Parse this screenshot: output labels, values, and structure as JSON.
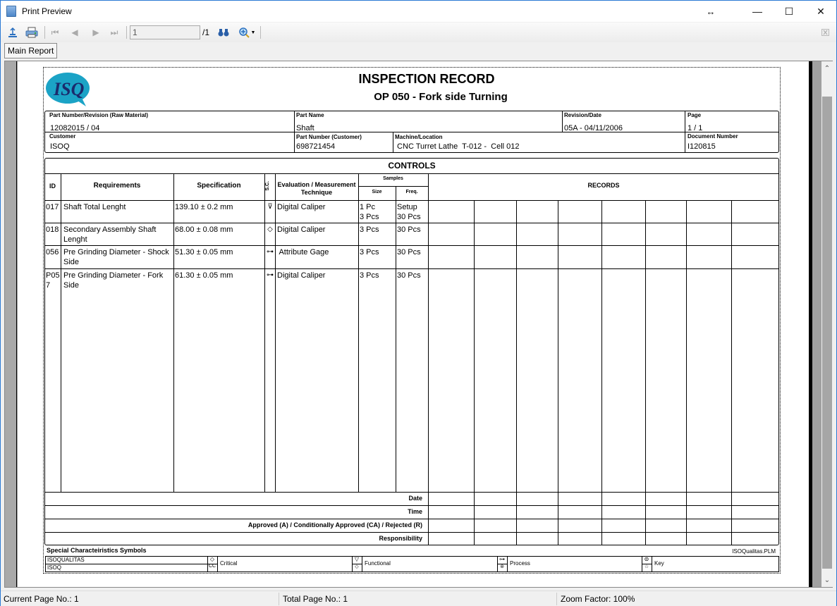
{
  "window": {
    "title": "Print Preview",
    "resize_icon": "↔",
    "minimize": "—",
    "maximize": "☐",
    "close": "✕"
  },
  "toolbar": {
    "export_icon": "export-icon",
    "print_icon": "print-icon",
    "current_page": "1",
    "total_pages": "/1",
    "find_icon": "binoculars-icon",
    "zoom_icon": "zoom-in-icon"
  },
  "tabs": [
    {
      "label": "Main Report"
    }
  ],
  "report": {
    "title": "INSPECTION RECORD",
    "subtitle": "OP 050 - Fork side Turning",
    "logo_text": "ISQ",
    "header": {
      "part_number_label": "Part Number/Revision (Raw Material)",
      "part_number": "12082015 / 04",
      "part_name_label": "Part Name",
      "part_name": "Shaft",
      "revision_label": "Revision/Date",
      "revision": "05A - 04/11/2006",
      "page_label": "Page",
      "page": "1 / 1",
      "customer_label": "Customer",
      "customer": "ISOQ",
      "part_number_customer_label": "Part Number (Customer)",
      "part_number_customer": "698721454",
      "machine_label": "Machine/Location",
      "machine": " CNC Turret Lathe  T-012 -  Cell 012",
      "document_number_label": "Document Number",
      "document_number": "I120815"
    },
    "controls_title": "CONTROLS",
    "columns": {
      "id": "ID",
      "requirements": "Requirements",
      "specification": "Specification",
      "sc": "S.C.",
      "evaluation": "Evaluation / Measurement Technique",
      "samples": "Samples",
      "size": "Size",
      "freq": "Freq.",
      "records": "RECORDS"
    },
    "rows": [
      {
        "id": "017",
        "requirement": "Shaft Total Lenght",
        "specification": "139.10 ± 0.2 mm",
        "sc_symbol": "⊽",
        "evaluation": "Digital Caliper",
        "size": "1 Pc\n3 Pcs",
        "freq": "Setup\n30 Pcs"
      },
      {
        "id": "018",
        "requirement": "Secondary Assembly Shaft Lenght",
        "specification": "68.00  ± 0.08 mm",
        "sc_symbol": "◇",
        "evaluation": "Digital Caliper",
        "size": "3 Pcs",
        "freq": "30 Pcs"
      },
      {
        "id": "056",
        "requirement": "Pre Grinding Diameter - Shock Side",
        "specification": "51.30  ± 0.05 mm",
        "sc_symbol": "⊶",
        "evaluation": " Attribute Gage",
        "size": "3 Pcs",
        "freq": "30 Pcs"
      },
      {
        "id": "P057",
        "requirement": "Pre Grinding Diameter - Fork Side",
        "specification": "61.30  ± 0.05 mm",
        "sc_symbol": "⊶",
        "evaluation": "Digital Caliper",
        "size": "3 Pcs",
        "freq": "30 Pcs"
      }
    ],
    "footer_rows": {
      "date": "Date",
      "time": "Time",
      "approval": "Approved (A) / Conditionally Approved (CA) / Rejected (R)",
      "responsibility": "Responsibility"
    },
    "legend": {
      "title": "Special Characteiristics Symbols",
      "source": "ISOQualitas.PLM",
      "company_1": "ISOQUALITAS",
      "company_2": "ISOQ",
      "items": [
        {
          "label": "Critical",
          "symbol_top": "◇",
          "symbol_bottom": "CC"
        },
        {
          "label": "Functional",
          "symbol_top": "▽",
          "symbol_bottom": "◇"
        },
        {
          "label": "Process",
          "symbol_top": "⊶",
          "symbol_bottom": "⊚"
        },
        {
          "label": "Key",
          "symbol_top": "⊜",
          "symbol_bottom": "☆"
        }
      ]
    }
  },
  "status": {
    "current_page": "Current Page No.: 1",
    "total_page": "Total Page No.: 1",
    "zoom": "Zoom Factor: 100%"
  }
}
